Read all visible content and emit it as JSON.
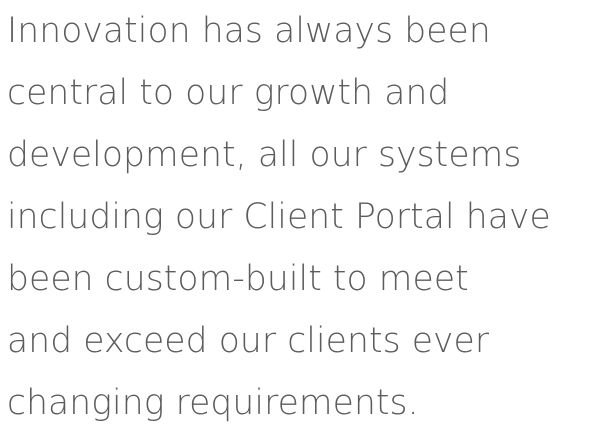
{
  "intro": {
    "lines": [
      "Innovation has always been",
      "central to our growth and",
      "development, all our systems",
      "including our Client Portal have",
      "been custom-built to meet",
      "and exceed our clients ever",
      "changing requirements."
    ]
  },
  "colors": {
    "text": "#5c5c5c",
    "background": "#ffffff"
  }
}
